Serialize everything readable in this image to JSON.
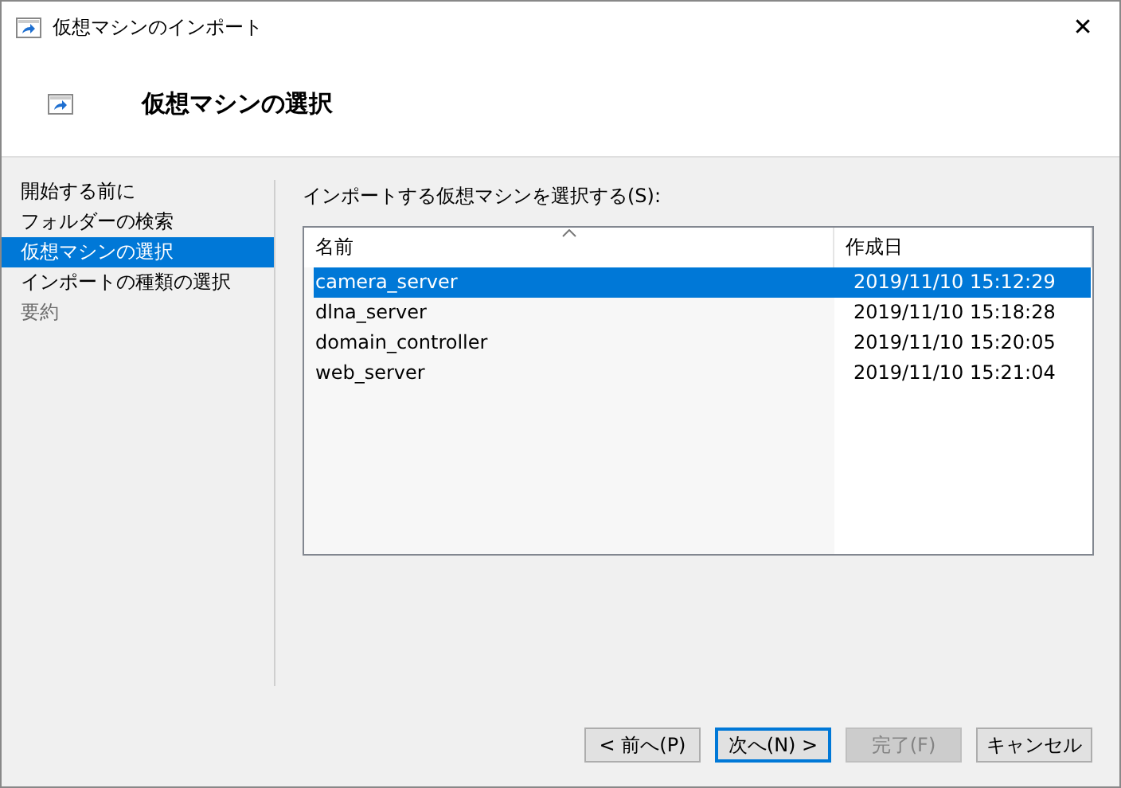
{
  "window": {
    "title": "仮想マシンのインポート",
    "close": "✕"
  },
  "header": {
    "title": "仮想マシンの選択"
  },
  "steps": [
    {
      "label": "開始する前に",
      "selected": false,
      "disabled": false
    },
    {
      "label": "フォルダーの検索",
      "selected": false,
      "disabled": false
    },
    {
      "label": "仮想マシンの選択",
      "selected": true,
      "disabled": false
    },
    {
      "label": "インポートの種類の選択",
      "selected": false,
      "disabled": false
    },
    {
      "label": "要約",
      "selected": false,
      "disabled": true
    }
  ],
  "list": {
    "label": "インポートする仮想マシンを選択する(S):",
    "columns": [
      {
        "label": "名前",
        "sorted": true
      },
      {
        "label": "作成日",
        "sorted": false
      }
    ],
    "rows": [
      {
        "name": "camera_server",
        "created": "2019/11/10 15:12:29",
        "selected": true
      },
      {
        "name": "dlna_server",
        "created": "2019/11/10 15:18:28",
        "selected": false
      },
      {
        "name": "domain_controller",
        "created": "2019/11/10 15:20:05",
        "selected": false
      },
      {
        "name": "web_server",
        "created": "2019/11/10 15:21:04",
        "selected": false
      }
    ]
  },
  "buttons": [
    {
      "label": "< 前へ(P)",
      "default": false,
      "disabled": false
    },
    {
      "label": "次へ(N) >",
      "default": true,
      "disabled": false
    },
    {
      "label": "完了(F)",
      "default": false,
      "disabled": true
    },
    {
      "label": "キャンセル",
      "default": false,
      "disabled": false
    }
  ]
}
